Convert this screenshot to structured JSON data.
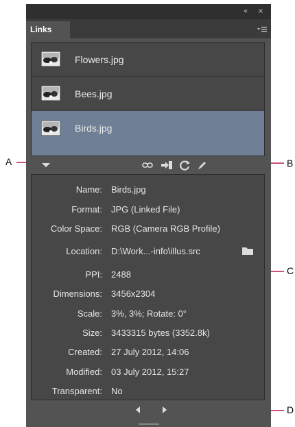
{
  "panel": {
    "tab_label": "Links",
    "titlebar": {
      "collapse_glyph": "«",
      "close_glyph": "×"
    }
  },
  "links": [
    {
      "name": "Flowers.jpg",
      "selected": false,
      "thumb_icon": "image-thumbnail"
    },
    {
      "name": "Bees.jpg",
      "selected": false,
      "thumb_icon": "image-thumbnail"
    },
    {
      "name": "Birds.jpg",
      "selected": true,
      "thumb_icon": "image-thumbnail"
    }
  ],
  "toolbar": {
    "icons": [
      "show-info-triangle-icon",
      "relink-icon",
      "go-to-link-icon",
      "update-link-icon",
      "edit-original-icon"
    ]
  },
  "info": [
    {
      "label": "Name:",
      "value": "Birds.jpg"
    },
    {
      "label": "Format:",
      "value": "JPG (Linked File)"
    },
    {
      "label": "Color Space:",
      "value": "RGB (Camera RGB Profile)"
    },
    {
      "label": "Location:",
      "value": "D:\\Work...-info\\illus.src"
    },
    {
      "label": "PPI:",
      "value": "2488"
    },
    {
      "label": "Dimensions:",
      "value": "3456x2304"
    },
    {
      "label": "Scale:",
      "value": "3%, 3%; Rotate: 0°"
    },
    {
      "label": "Size:",
      "value": "3433315 bytes (3352.8k)"
    },
    {
      "label": "Created:",
      "value": "27 July 2012, 14:06"
    },
    {
      "label": "Modified:",
      "value": "03 July 2012, 15:27"
    },
    {
      "label": "Transparent:",
      "value": "No"
    }
  ],
  "callouts": {
    "a": "A",
    "b": "B",
    "c": "C",
    "d": "D"
  },
  "colors": {
    "callout_line": "#c8557f",
    "selection": "#6f7f95",
    "panel_bg": "#535353"
  }
}
